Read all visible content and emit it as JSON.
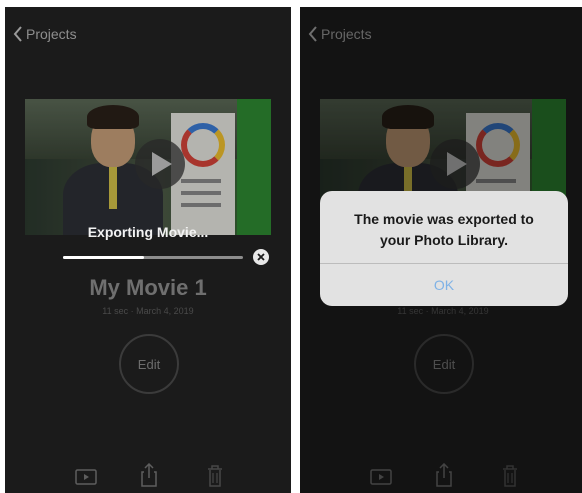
{
  "left_screen": {
    "nav": {
      "back_label": "Projects"
    },
    "export_label": "Exporting Movie...",
    "export_progress": 0.45,
    "project_title": "My Movie 1",
    "project_meta": "11 sec · March 4, 2019",
    "edit_label": "Edit",
    "toolbar": {
      "icons": [
        "play-icon",
        "share-icon",
        "trash-icon"
      ]
    }
  },
  "right_screen": {
    "nav": {
      "back_label": "Projects"
    },
    "alert": {
      "message_line1": "The movie was exported to",
      "message_line2": "your Photo Library.",
      "ok_label": "OK"
    },
    "project_meta": "11 sec · March 4, 2019",
    "edit_label": "Edit",
    "toolbar": {
      "icons": [
        "play-icon",
        "share-icon",
        "trash-icon"
      ]
    }
  },
  "colors": {
    "background": "#1b1b1b",
    "alert_bg": "#e2e2e2",
    "ok_text": "#7fb2e6"
  }
}
